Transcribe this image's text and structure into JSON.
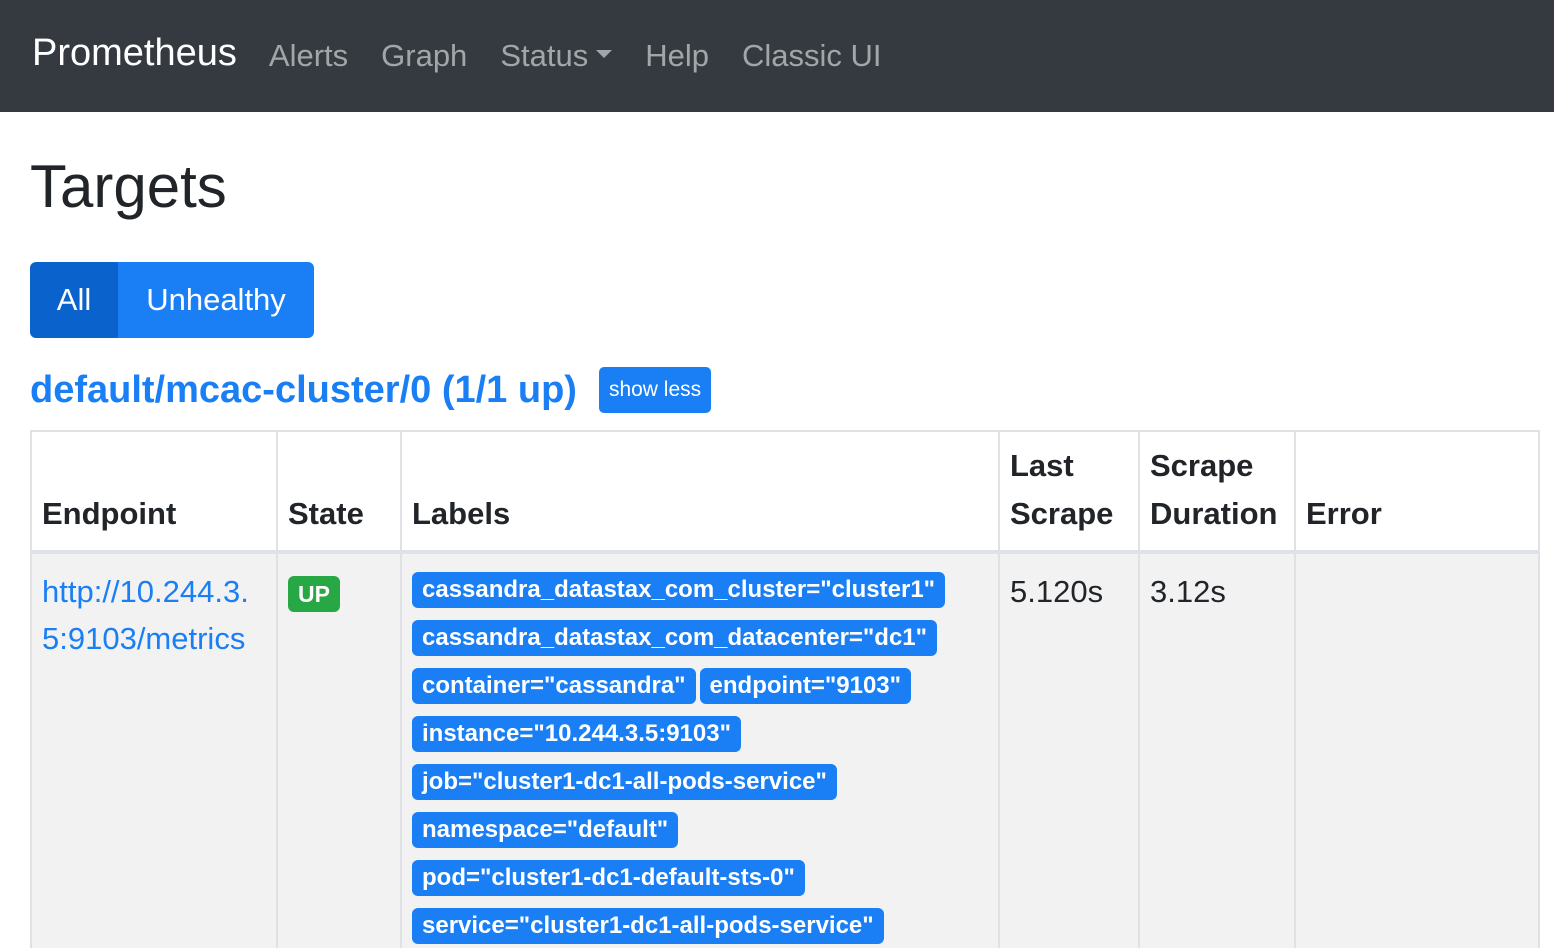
{
  "navbar": {
    "brand": "Prometheus",
    "items": [
      {
        "label": "Alerts"
      },
      {
        "label": "Graph"
      },
      {
        "label": "Status"
      },
      {
        "label": "Help"
      },
      {
        "label": "Classic UI"
      }
    ]
  },
  "page": {
    "title": "Targets",
    "filters": {
      "all": "All",
      "unhealthy": "Unhealthy"
    }
  },
  "job": {
    "title": "default/mcac-cluster/0 (1/1 up)",
    "toggle": "show less"
  },
  "table": {
    "headers": {
      "endpoint": "Endpoint",
      "state": "State",
      "labels": "Labels",
      "last_scrape_line1": "Last",
      "last_scrape_line2": "Scrape",
      "duration_line1": "Scrape",
      "duration_line2": "Duration",
      "error": "Error"
    },
    "row": {
      "endpoint": "http://10.244.3.5:9103/metrics",
      "state": "UP",
      "labels": [
        "cassandra_datastax_com_cluster=\"cluster1\"",
        "cassandra_datastax_com_datacenter=\"dc1\"",
        "container=\"cassandra\"",
        "endpoint=\"9103\"",
        "instance=\"10.244.3.5:9103\"",
        "job=\"cluster1-dc1-all-pods-service\"",
        "namespace=\"default\"",
        "pod=\"cluster1-dc1-default-sts-0\"",
        "service=\"cluster1-dc1-all-pods-service\""
      ],
      "last_scrape": "5.120s",
      "scrape_duration": "3.12s",
      "error": ""
    }
  },
  "colors": {
    "navbar_bg": "#343a40",
    "primary": "#1a7ff5",
    "primary_active": "#0a62cc",
    "success": "#28a745"
  }
}
